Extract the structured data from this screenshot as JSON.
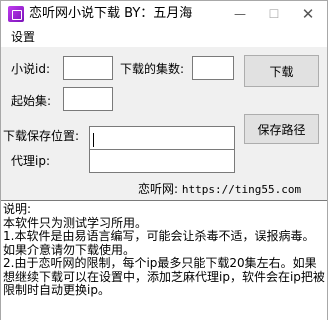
{
  "window": {
    "title": "恋听网小说下载 BY：五月海",
    "minimize_glyph": "—",
    "maximize_glyph": "☐",
    "close_glyph": "✕",
    "icon": "app-icon"
  },
  "menu": {
    "settings": "设置"
  },
  "form": {
    "novel_id_label": "小说id:",
    "novel_id_value": "",
    "episode_count_label": "下载的集数:",
    "episode_count_value": "",
    "start_episode_label": "起始集:",
    "start_episode_value": "",
    "save_location_label": "下载保存位置:",
    "save_location_value": "",
    "proxy_label": "代理ip:",
    "proxy_value": ""
  },
  "buttons": {
    "download": "下载",
    "save_path": "保存路径"
  },
  "site": {
    "label": "恋听网: ",
    "url": "https://ting55.com"
  },
  "notes": {
    "line1": "说明:",
    "line2": "本软件只为测试学习所用。",
    "line3": "1.本软件是由易语言编写，可能会让杀毒不适，误报病毒。如果介意请勿下载使用。",
    "line4": "2.由于恋听网的限制，每个ip最多只能下载20集左右。如果想继续下载可以在设置中，添加芝麻代理ip，软件会在ip把被限制时自动更换ip。"
  }
}
